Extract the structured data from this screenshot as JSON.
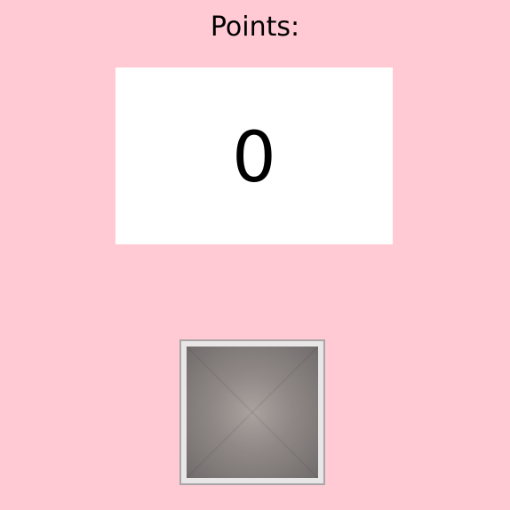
{
  "header": {
    "points_label": "Points:"
  },
  "score": {
    "value": "0"
  },
  "button": {
    "icon": "square-button",
    "colors": {
      "frame": "#e8e6e6",
      "face_center": "#aaa39f",
      "face_edge": "#716c6c"
    }
  },
  "colors": {
    "background": "#ffcad4",
    "score_box": "#ffffff"
  }
}
